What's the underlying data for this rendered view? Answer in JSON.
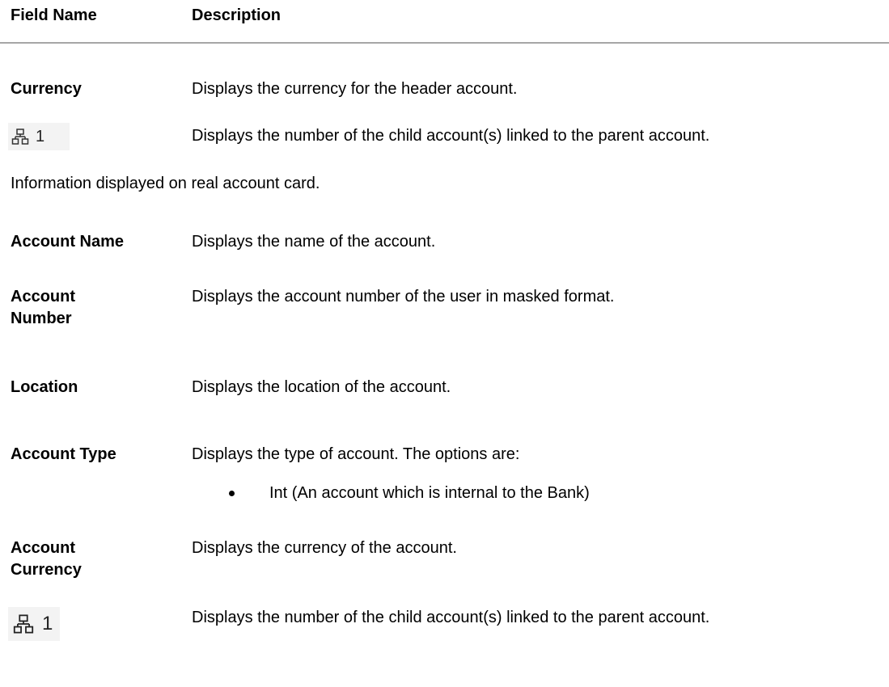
{
  "table1": {
    "header": {
      "field_name": "Field Name",
      "description": "Description"
    },
    "rows": [
      {
        "field": "Currency",
        "description": "Displays the currency for the header account."
      },
      {
        "icon": "hierarchy-icon",
        "count": "1",
        "description": "Displays the number of the child account(s) linked to the parent account."
      }
    ]
  },
  "intro": "Information displayed on real account card.",
  "table2": {
    "rows": [
      {
        "field": "Account Name",
        "description": "Displays the name of the account."
      },
      {
        "field_line1": "Account",
        "field_line2": "Number",
        "description": "Displays the account number of the user in masked format."
      },
      {
        "field": "Location",
        "description": "Displays the location of the account."
      },
      {
        "field": "Account Type",
        "description": "Displays the type of account. The options are:",
        "bullets": [
          "Int (An account which is internal to the Bank)"
        ]
      },
      {
        "field_line1": "Account",
        "field_line2": "Currency",
        "description": "Displays the currency of the account."
      },
      {
        "icon": "hierarchy-icon",
        "count": "1",
        "description": "Displays the number of the child account(s) linked to the parent account."
      }
    ]
  }
}
